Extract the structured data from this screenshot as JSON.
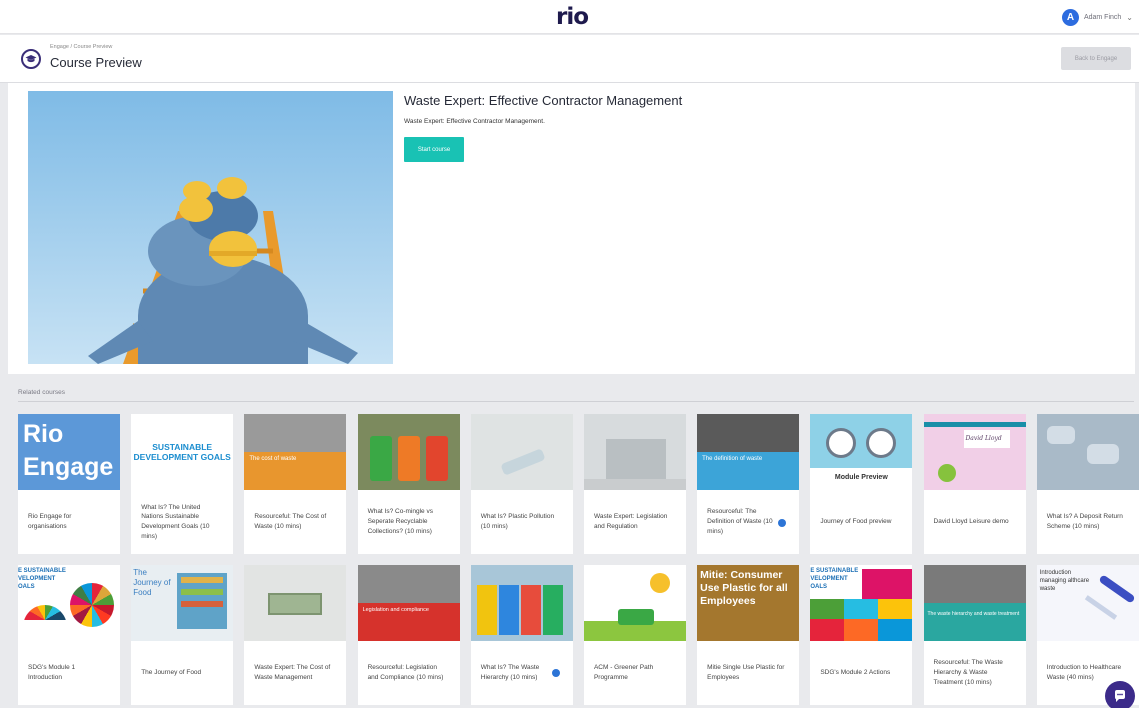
{
  "header": {
    "logo": "rio",
    "user_initial": "A",
    "user_name": "Adam Finch",
    "user_chevron": "⌄"
  },
  "subheader": {
    "breadcrumb": "Engage / Course Preview",
    "title": "Course Preview",
    "back_button": "Back to Engage"
  },
  "course": {
    "title": "Waste Expert: Effective Contractor Management",
    "description": "Waste Expert: Effective Contractor Management.",
    "start_button": "Start course"
  },
  "related": {
    "label": "Related courses",
    "courses": [
      {
        "title": "Rio Engage for organisations",
        "thumb_text": "Rio Engage",
        "duration_icon": false
      },
      {
        "title": "What Is? The United Nations Sustainable Development Goals (10 mins)",
        "thumb_text": "SUSTAINABLE DEVELOPMENT GOALS",
        "duration_icon": false
      },
      {
        "title": "Resourceful: The Cost of Waste (10 mins)",
        "thumb_text": "The cost of waste",
        "duration_icon": false
      },
      {
        "title": "What Is? Co-mingle vs Seperate Recyclable Collections? (10 mins)",
        "thumb_text": "",
        "duration_icon": false
      },
      {
        "title": "What Is? Plastic Pollution (10 mins)",
        "thumb_text": "",
        "duration_icon": false
      },
      {
        "title": "Waste Expert: Legislation and Regulation",
        "thumb_text": "",
        "duration_icon": false
      },
      {
        "title": "Resourceful: The Definition of Waste (10 mins)",
        "thumb_text": "The definition of waste",
        "duration_icon": true
      },
      {
        "title": "Journey of Food preview",
        "thumb_text": "Module Preview",
        "duration_icon": false
      },
      {
        "title": "David Lloyd Leisure demo",
        "thumb_text": "David Lloyd",
        "duration_icon": false
      },
      {
        "title": "What Is? A Deposit Return Scheme (10 mins)",
        "thumb_text": "",
        "duration_icon": false
      },
      {
        "title": "SDG's Module 1 Introduction",
        "thumb_text": "E SUSTAINABLE VELOPMENT OALS",
        "duration_icon": false
      },
      {
        "title": "The Journey of Food",
        "thumb_text": "The Journey of Food",
        "duration_icon": false
      },
      {
        "title": "Waste Expert: The Cost of Waste Management",
        "thumb_text": "",
        "duration_icon": false
      },
      {
        "title": "Resourceful: Legislation and Compliance (10 mins)",
        "thumb_text": "Legislation and compliance",
        "duration_icon": false
      },
      {
        "title": "What Is? The Waste Hierarchy (10 mins)",
        "thumb_text": "",
        "duration_icon": true
      },
      {
        "title": "ACM - Greener Path Programme",
        "thumb_text": "",
        "duration_icon": false
      },
      {
        "title": "Mitie Single Use Plastic for Employees",
        "thumb_text": "Mitie: Consumer Use Plastic for all Employees",
        "duration_icon": false
      },
      {
        "title": "SDG's Module 2 Actions",
        "thumb_text": "E SUSTAINABLE VELOPMENT OALS",
        "duration_icon": false
      },
      {
        "title": "Resourceful: The Waste Hierarchy & Waste Treatment (10 mins)",
        "thumb_text": "The waste hierarchy and waste treatment",
        "duration_icon": false
      },
      {
        "title": "Introduction to Healthcare Waste (40 mins)",
        "thumb_text": "Introduction managing althcare waste",
        "duration_icon": false
      }
    ]
  },
  "colors": {
    "brand": "#1e1a4d",
    "accent": "#19c2b4",
    "chat": "#3c2b8a",
    "avatar": "#2d6cdf"
  },
  "icons": {
    "course": "graduation-cap-icon",
    "chat": "chat-bubble-icon",
    "duration": "clock-icon"
  }
}
